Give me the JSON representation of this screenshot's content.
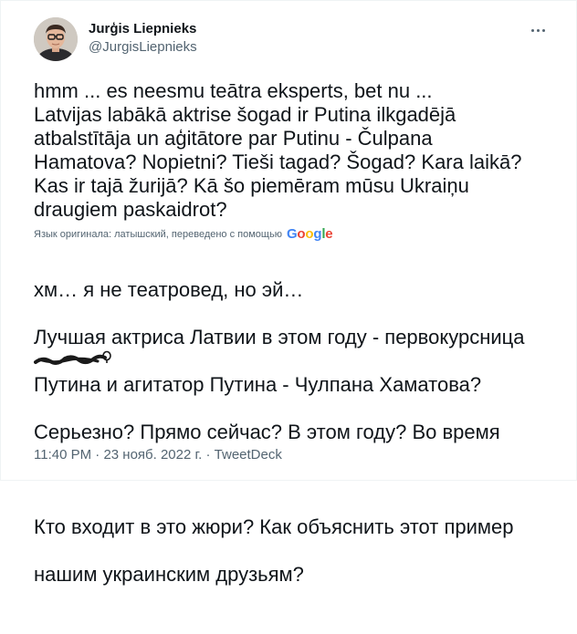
{
  "author": {
    "display_name": "Jurģis Liepnieks",
    "handle": "@JurgisLiepnieks"
  },
  "tweet": {
    "text": "hmm ... es neesmu teātra eksperts, bet nu ...\nLatvijas labākā aktrise šogad ir Putina ilkgadējā\natbalstītāja un aģitātore par Putinu  - Čulpana\nHamatova? Nopietni? Tieši tagad? Šogad? Kara laikā?\nKas ir tajā žurijā? Kā šo piemēram mūsu Ukraiņu\ndraugiem paskaidrot?",
    "translation_note": "Язык оригинала: латышский, переведено с помощью",
    "translation_provider": "Google",
    "translated_lines": [
      "хм… я не театровед, но эй…",
      "Лучшая актриса Латвии в этом году - первокурсница",
      "Путина и агитатор Путина - Чулпана Хаматова?",
      "Серьезно? Прямо сейчас? В этом году? Во время",
      "",
      "Кто входит в это жюри? Как объяснить этот пример",
      "нашим украинским друзьям?"
    ]
  },
  "meta": {
    "time": "11:40 PM",
    "separator": "·",
    "date": "23 нояб. 2022 г.",
    "source": "TweetDeck"
  },
  "icons": {
    "more": "more-horizontal-icon",
    "google": "google-logo"
  },
  "colors": {
    "text": "#0f1419",
    "secondary": "#536471",
    "google_blue": "#4285f4",
    "google_red": "#ea4335",
    "google_yellow": "#fbbc05",
    "google_green": "#34a853"
  }
}
